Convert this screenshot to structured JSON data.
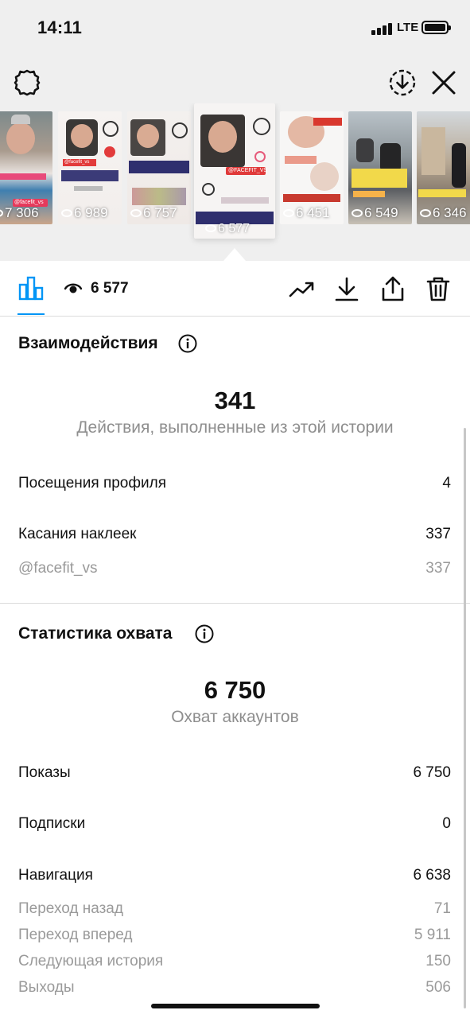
{
  "status": {
    "time": "14:11",
    "network": "LTE"
  },
  "icons": {
    "settings": "gear-icon",
    "save": "download-circle-icon",
    "close": "close-icon"
  },
  "thumbnails": [
    {
      "views": "7 306",
      "handle": "@facefit_vs"
    },
    {
      "views": "6 989",
      "handle": "@facefit_vs"
    },
    {
      "views": "6 757"
    },
    {
      "views": "6 577",
      "handle": "@FACEFIT_VS",
      "active": true
    },
    {
      "views": "6 451"
    },
    {
      "views": "6 549"
    },
    {
      "views": "6 346"
    }
  ],
  "toolbar": {
    "views": "6 577"
  },
  "interactions": {
    "title": "Взаимодействия",
    "total": "341",
    "caption": "Действия, выполненные из этой истории",
    "rows": [
      {
        "label": "Посещения профиля",
        "value": "4"
      },
      {
        "label": "Касания наклеек",
        "value": "337"
      },
      {
        "label": "@facefit_vs",
        "value": "337"
      }
    ]
  },
  "reach": {
    "title": "Статистика охвата",
    "total": "6 750",
    "caption": "Охват аккаунтов",
    "rows": [
      {
        "label": "Показы",
        "value": "6 750"
      },
      {
        "label": "Подписки",
        "value": "0"
      },
      {
        "label": "Навигация",
        "value": "6 638"
      }
    ],
    "navigation": [
      {
        "label": "Переход назад",
        "value": "71"
      },
      {
        "label": "Переход вперед",
        "value": "5 911"
      },
      {
        "label": "Следующая история",
        "value": "150"
      },
      {
        "label": "Выходы",
        "value": "506"
      }
    ]
  },
  "colors": {
    "accent": "#0095f6",
    "muted": "#8e8e8e",
    "background_top": "#efefef"
  }
}
